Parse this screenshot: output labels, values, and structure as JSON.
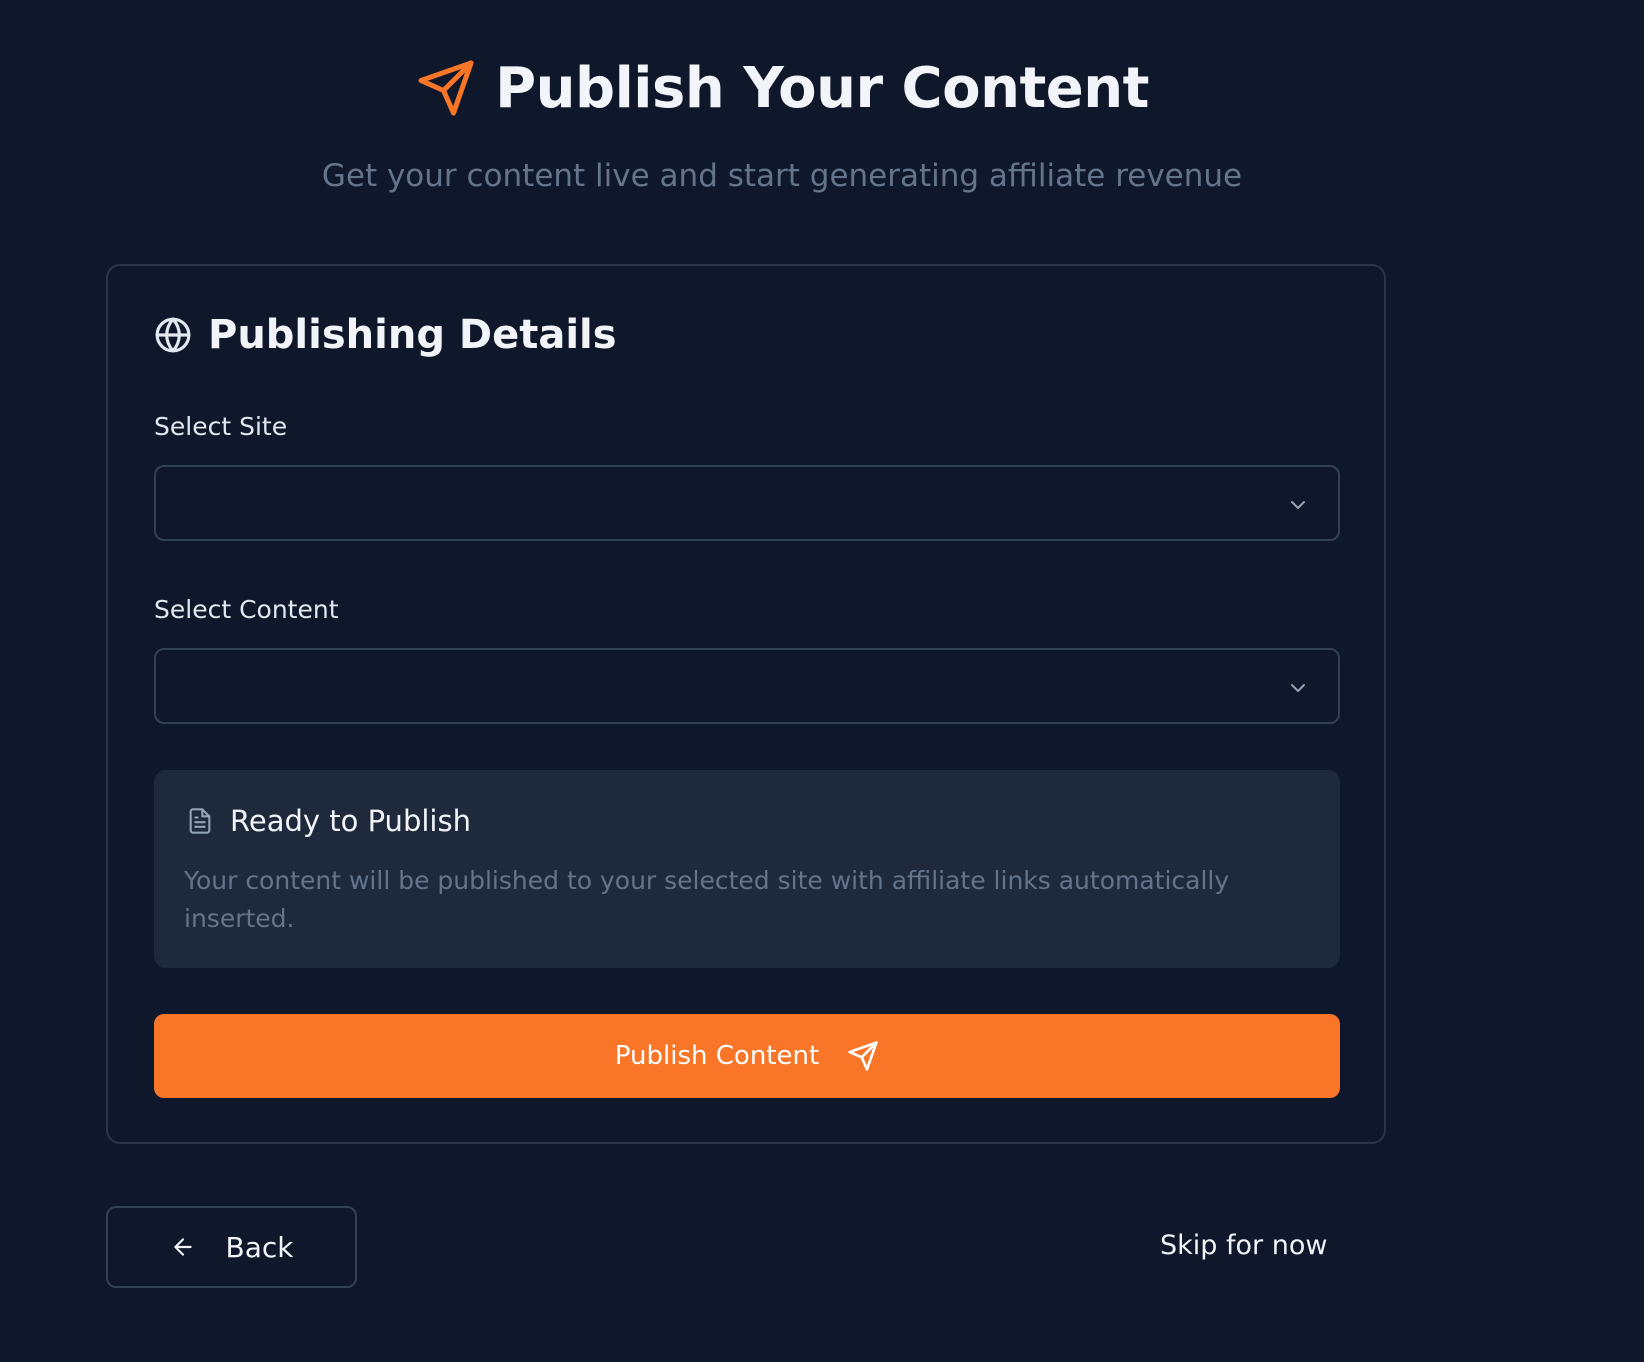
{
  "header": {
    "title": "Publish Your Content",
    "subtitle": "Get your content live and start generating affiliate revenue",
    "icon": "send-icon"
  },
  "card": {
    "title": "Publishing Details",
    "icon": "globe-icon",
    "site_field": {
      "label": "Select Site",
      "value": ""
    },
    "content_field": {
      "label": "Select Content",
      "value": ""
    },
    "info": {
      "icon": "file-text-icon",
      "title": "Ready to Publish",
      "text": "Your content will be published to your selected site with affiliate links automatically inserted."
    },
    "publish_button": {
      "label": "Publish Content",
      "icon": "send-icon"
    }
  },
  "footer": {
    "back_label": "Back",
    "back_icon": "arrow-left-icon",
    "skip_label": "Skip for now"
  },
  "colors": {
    "background": "#0f172a",
    "accent": "#f97628",
    "panel": "#1e293b",
    "border": "#334155",
    "muted_text": "#64748b"
  }
}
